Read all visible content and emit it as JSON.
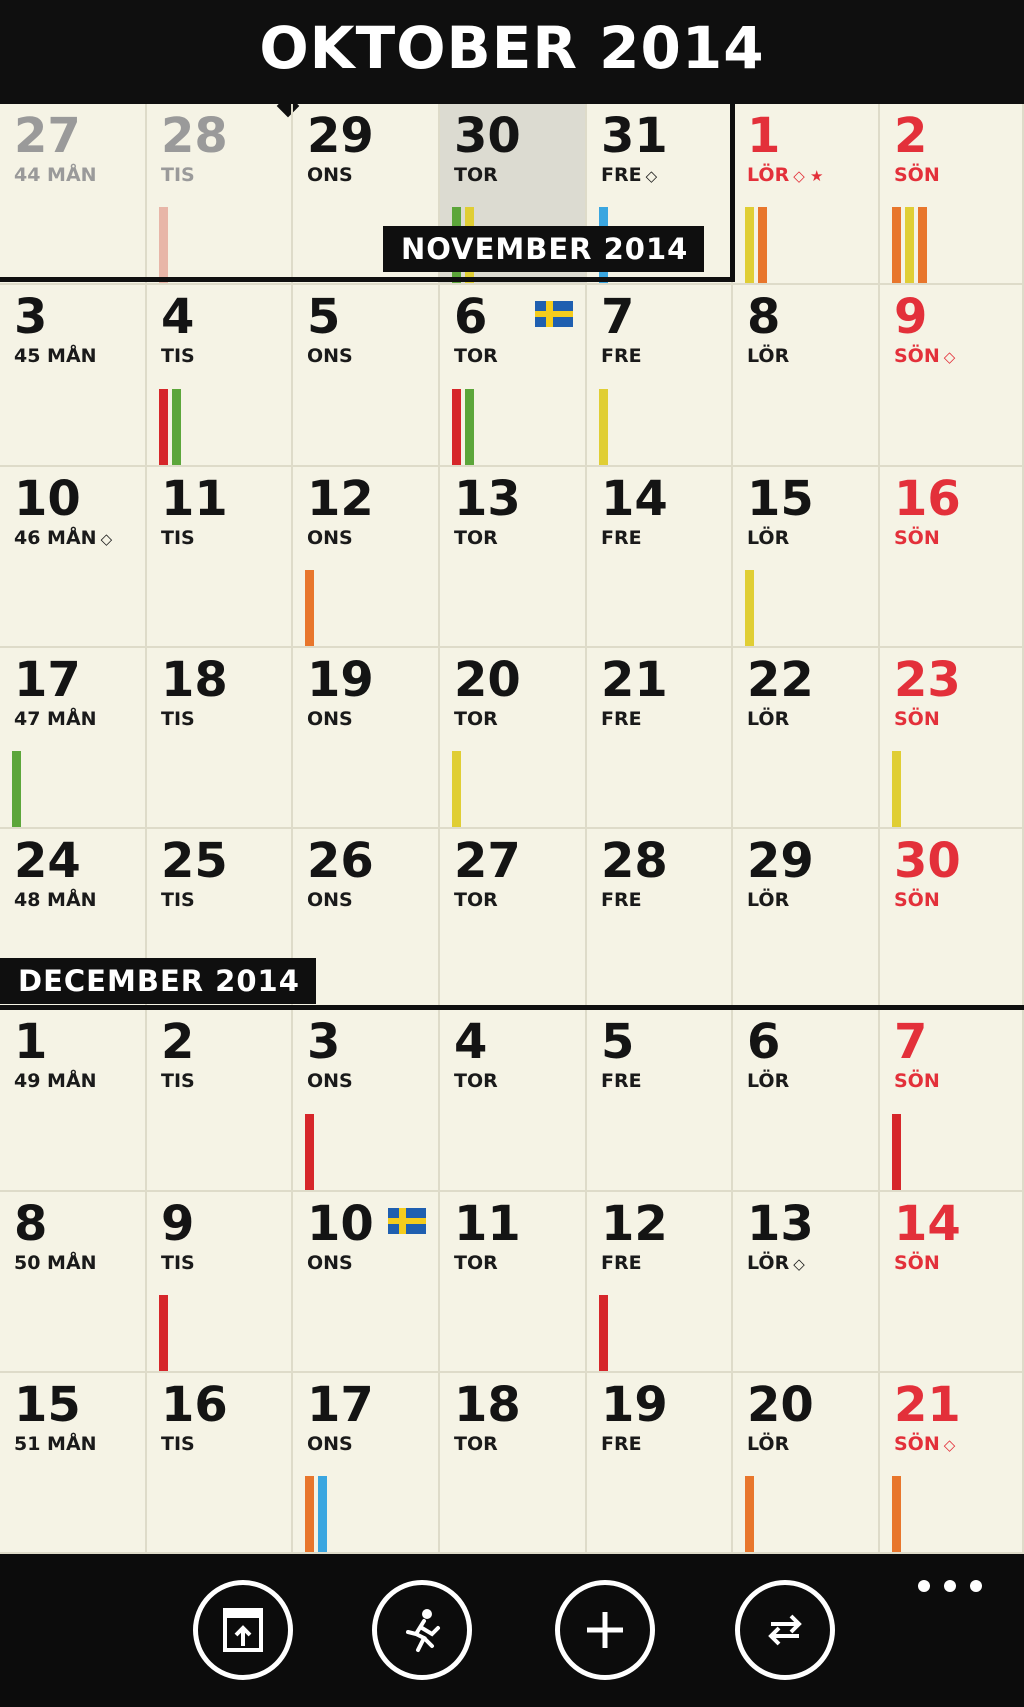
{
  "header": {
    "title": "OKTOBER 2014"
  },
  "months": [
    {
      "label": "NOVEMBER 2014"
    },
    {
      "label": "DECEMBER 2014"
    }
  ],
  "colors": {
    "red": "#d6262a",
    "green": "#5ca63a",
    "yellow": "#e0ce34",
    "orange": "#e8762c",
    "blue": "#3aa6e0",
    "pink": "#e8b6a8"
  },
  "weeks": [
    {
      "days": [
        {
          "num": "27",
          "label": "44 MÅN",
          "state": "prev"
        },
        {
          "num": "28",
          "label": "TIS",
          "state": "prev",
          "bars": [
            "pink"
          ]
        },
        {
          "num": "29",
          "label": "ONS"
        },
        {
          "num": "30",
          "label": "TOR",
          "highlight": true,
          "bars": [
            "green",
            "yellow"
          ]
        },
        {
          "num": "31",
          "label": "FRE",
          "sym": "◇",
          "bars": [
            "blue"
          ]
        },
        {
          "num": "1",
          "label": "LÖR",
          "sym": "◇ ★",
          "red": true,
          "bars": [
            "yellow",
            "orange"
          ]
        },
        {
          "num": "2",
          "label": "SÖN",
          "red": true,
          "bars": [
            "orange",
            "yellow",
            "orange"
          ]
        }
      ]
    },
    {
      "days": [
        {
          "num": "3",
          "label": "45 MÅN"
        },
        {
          "num": "4",
          "label": "TIS",
          "bars": [
            "red",
            "green"
          ]
        },
        {
          "num": "5",
          "label": "ONS"
        },
        {
          "num": "6",
          "label": "TOR",
          "flag": true,
          "bars": [
            "red",
            "green"
          ]
        },
        {
          "num": "7",
          "label": "FRE",
          "bars": [
            "yellow"
          ]
        },
        {
          "num": "8",
          "label": "LÖR"
        },
        {
          "num": "9",
          "label": "SÖN",
          "sym": "◇",
          "red": true
        }
      ]
    },
    {
      "days": [
        {
          "num": "10",
          "label": "46 MÅN",
          "sym": "◇"
        },
        {
          "num": "11",
          "label": "TIS"
        },
        {
          "num": "12",
          "label": "ONS",
          "bars": [
            "orange"
          ]
        },
        {
          "num": "13",
          "label": "TOR"
        },
        {
          "num": "14",
          "label": "FRE"
        },
        {
          "num": "15",
          "label": "LÖR",
          "bars": [
            "yellow"
          ]
        },
        {
          "num": "16",
          "label": "SÖN",
          "red": true
        }
      ]
    },
    {
      "days": [
        {
          "num": "17",
          "label": "47 MÅN",
          "bars": [
            "green"
          ]
        },
        {
          "num": "18",
          "label": "TIS"
        },
        {
          "num": "19",
          "label": "ONS"
        },
        {
          "num": "20",
          "label": "TOR",
          "bars": [
            "yellow"
          ]
        },
        {
          "num": "21",
          "label": "FRE"
        },
        {
          "num": "22",
          "label": "LÖR"
        },
        {
          "num": "23",
          "label": "SÖN",
          "red": true,
          "bars": [
            "yellow"
          ]
        }
      ]
    },
    {
      "days": [
        {
          "num": "24",
          "label": "48 MÅN"
        },
        {
          "num": "25",
          "label": "TIS"
        },
        {
          "num": "26",
          "label": "ONS"
        },
        {
          "num": "27",
          "label": "TOR"
        },
        {
          "num": "28",
          "label": "FRE"
        },
        {
          "num": "29",
          "label": "LÖR"
        },
        {
          "num": "30",
          "label": "SÖN",
          "red": true
        }
      ]
    },
    {
      "days": [
        {
          "num": "1",
          "label": "49 MÅN"
        },
        {
          "num": "2",
          "label": "TIS"
        },
        {
          "num": "3",
          "label": "ONS",
          "bars": [
            "red"
          ]
        },
        {
          "num": "4",
          "label": "TOR"
        },
        {
          "num": "5",
          "label": "FRE"
        },
        {
          "num": "6",
          "label": "LÖR"
        },
        {
          "num": "7",
          "label": "SÖN",
          "red": true,
          "bars": [
            "red"
          ]
        }
      ]
    },
    {
      "days": [
        {
          "num": "8",
          "label": "50 MÅN"
        },
        {
          "num": "9",
          "label": "TIS",
          "bars": [
            "red"
          ]
        },
        {
          "num": "10",
          "label": "ONS",
          "flag": true
        },
        {
          "num": "11",
          "label": "TOR"
        },
        {
          "num": "12",
          "label": "FRE",
          "bars": [
            "red"
          ]
        },
        {
          "num": "13",
          "label": "LÖR",
          "sym": "◇"
        },
        {
          "num": "14",
          "label": "SÖN",
          "red": true
        }
      ]
    },
    {
      "days": [
        {
          "num": "15",
          "label": "51 MÅN"
        },
        {
          "num": "16",
          "label": "TIS"
        },
        {
          "num": "17",
          "label": "ONS",
          "bars": [
            "orange",
            "blue"
          ]
        },
        {
          "num": "18",
          "label": "TOR"
        },
        {
          "num": "19",
          "label": "FRE"
        },
        {
          "num": "20",
          "label": "LÖR",
          "bars": [
            "orange"
          ]
        },
        {
          "num": "21",
          "label": "SÖN",
          "sym": "◇",
          "red": true,
          "bars": [
            "orange"
          ]
        }
      ]
    }
  ],
  "appbar": {
    "buttons": [
      {
        "icon": "calendar-today-icon"
      },
      {
        "icon": "running-man-icon"
      },
      {
        "icon": "plus-icon"
      },
      {
        "icon": "swap-arrows-icon"
      }
    ],
    "more_icon": "ellipsis-icon"
  }
}
